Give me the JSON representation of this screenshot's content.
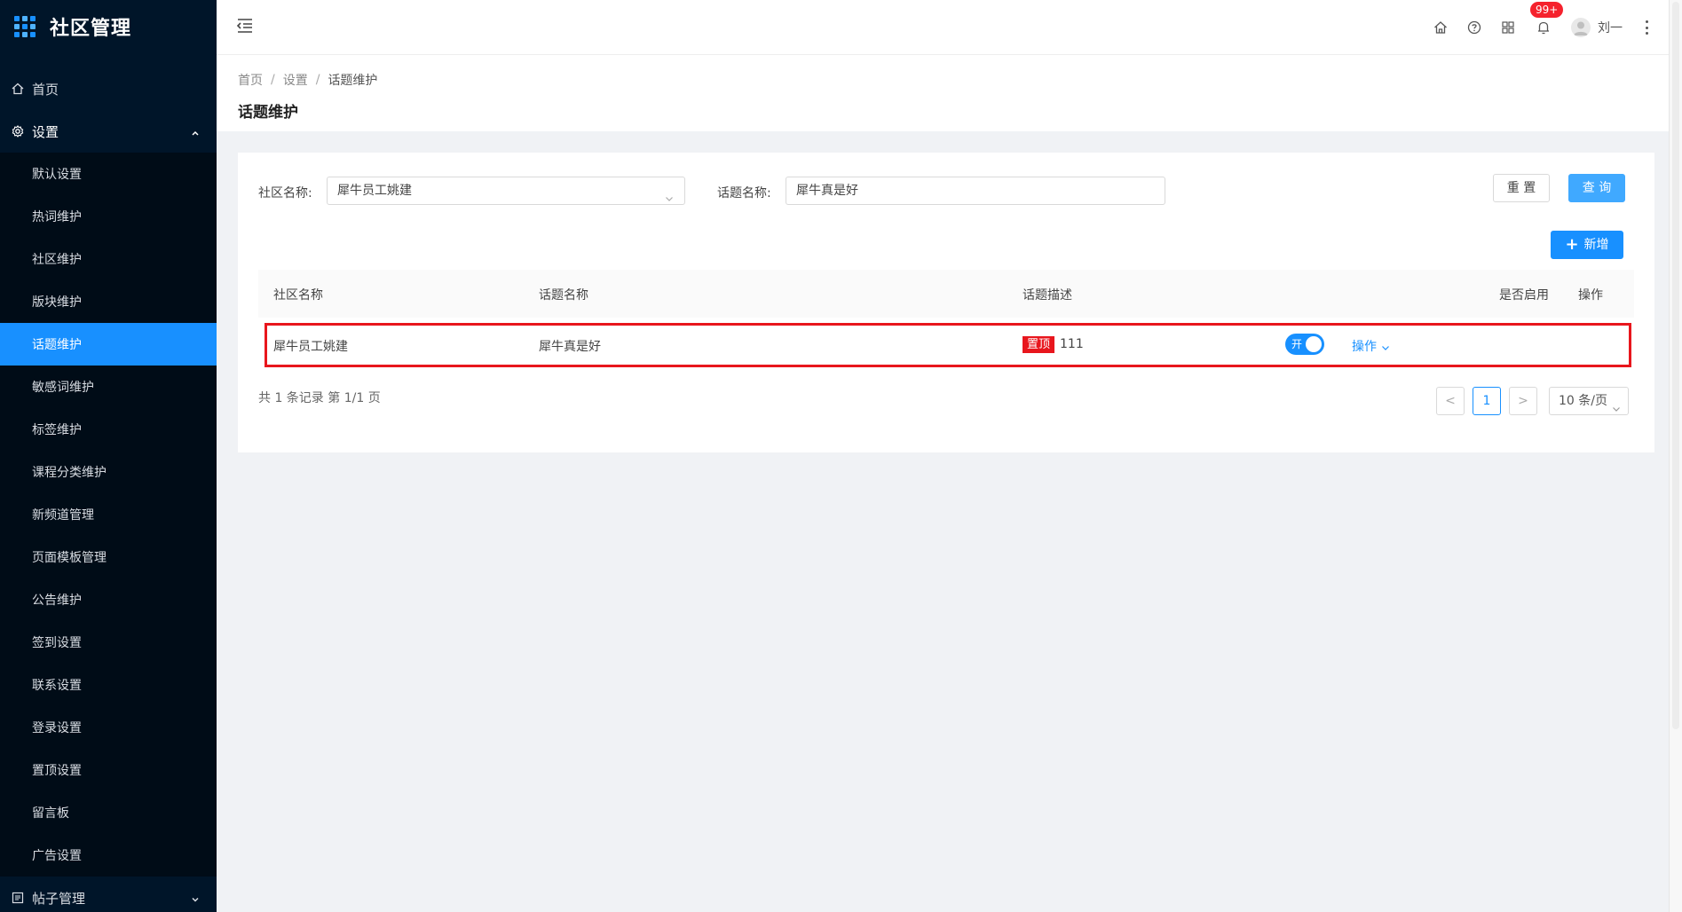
{
  "app": {
    "title": "社区管理"
  },
  "sidebar": {
    "items": [
      {
        "label": "首页",
        "icon": "home-icon"
      },
      {
        "label": "设置",
        "icon": "settings-icon",
        "open": true
      }
    ],
    "submenu": [
      "默认设置",
      "热词维护",
      "社区维护",
      "版块维护",
      "话题维护",
      "敏感词维护",
      "标签维护",
      "课程分类维护",
      "新频道管理",
      "页面模板管理",
      "公告维护",
      "签到设置",
      "联系设置",
      "登录设置",
      "置顶设置",
      "留言板",
      "广告设置"
    ],
    "active_sub": "话题维护",
    "bottom_item": {
      "label": "帖子管理",
      "icon": "list-icon"
    }
  },
  "header": {
    "badge": "99+",
    "username": "刘一"
  },
  "page": {
    "breadcrumb": [
      "首页",
      "设置",
      "话题维护"
    ],
    "title": "话题维护"
  },
  "filters": {
    "community_label": "社区名称:",
    "community_value": "犀牛员工姚建",
    "topic_label": "话题名称:",
    "topic_value": "犀牛真是好",
    "reset_label": "重 置",
    "query_label": "查 询",
    "add_label": "新增"
  },
  "table": {
    "columns": [
      "社区名称",
      "话题名称",
      "话题描述",
      "是否启用",
      "操作"
    ],
    "rows": [
      {
        "community": "犀牛员工姚建",
        "topic": "犀牛真是好",
        "tag": "置顶",
        "description": "111",
        "enabled_label": "开",
        "enabled": true,
        "action": "操作"
      }
    ]
  },
  "pagination": {
    "summary": "共 1 条记录 第 1/1 页",
    "current": "1",
    "prev": "<",
    "next": ">",
    "page_size": "10 条/页"
  },
  "colors": {
    "sidebar_bg": "#001529",
    "accent": "#1890ff",
    "highlight_border": "#e8161d"
  }
}
